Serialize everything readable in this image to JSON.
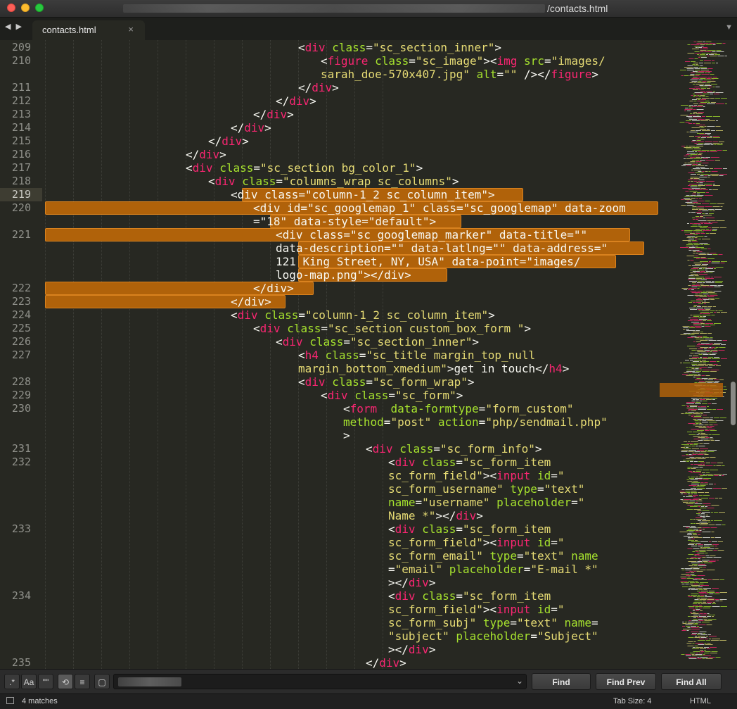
{
  "window": {
    "title_suffix": "/contacts.html",
    "title_path_redacted": true
  },
  "tabs": [
    {
      "label": "contacts.html",
      "close_icon": "×"
    }
  ],
  "nav_arrows": "◀ ▶",
  "colors": {
    "background": "#272822",
    "tag": "#f92672",
    "attribute": "#a6e22e",
    "string": "#e6db74",
    "text": "#f8f8f2",
    "gutter": "#8f908a",
    "match_highlight": "#b0620a"
  },
  "editor": {
    "line_numbers": [
      "209",
      "210",
      "211",
      "212",
      "213",
      "214",
      "215",
      "216",
      "217",
      "218",
      "219",
      "220",
      "221",
      "222",
      "223",
      "224",
      "225",
      "226",
      "227",
      "228",
      "229",
      "230",
      "231",
      "232",
      "233",
      "234",
      "235"
    ],
    "current_line": "219",
    "code_lines": [
      {
        "segments": [
          [
            "p",
            "<"
          ],
          [
            "t",
            "div"
          ],
          [
            "p",
            " "
          ],
          [
            "a",
            "class"
          ],
          [
            "p",
            "="
          ],
          [
            "s",
            "\"sc_section_inner\""
          ],
          [
            "p",
            ">"
          ]
        ]
      },
      {
        "segments": [
          [
            "p",
            "<"
          ],
          [
            "t",
            "figure"
          ],
          [
            "p",
            " "
          ],
          [
            "a",
            "class"
          ],
          [
            "p",
            "="
          ],
          [
            "s",
            "\"sc_image\""
          ],
          [
            "p",
            "><"
          ],
          [
            "t",
            "img"
          ],
          [
            "p",
            " "
          ],
          [
            "a",
            "src"
          ],
          [
            "p",
            "="
          ],
          [
            "s",
            "\"images/"
          ]
        ]
      },
      {
        "segments": [
          [
            "s",
            "sarah_doe-570x407.jpg\""
          ],
          [
            "p",
            " "
          ],
          [
            "a",
            "alt"
          ],
          [
            "p",
            "="
          ],
          [
            "s",
            "\"\""
          ],
          [
            "p",
            " /></"
          ],
          [
            "t",
            "figure"
          ],
          [
            "p",
            ">"
          ]
        ]
      },
      {
        "segments": [
          [
            "p",
            "</"
          ],
          [
            "t",
            "div"
          ],
          [
            "p",
            ">"
          ]
        ]
      },
      {
        "segments": [
          [
            "p",
            "</"
          ],
          [
            "t",
            "div"
          ],
          [
            "p",
            ">"
          ]
        ]
      },
      {
        "segments": [
          [
            "p",
            "</"
          ],
          [
            "t",
            "div"
          ],
          [
            "p",
            ">"
          ]
        ]
      },
      {
        "segments": [
          [
            "p",
            "</"
          ],
          [
            "t",
            "div"
          ],
          [
            "p",
            ">"
          ]
        ]
      },
      {
        "segments": [
          [
            "p",
            "</"
          ],
          [
            "t",
            "div"
          ],
          [
            "p",
            ">"
          ]
        ]
      },
      {
        "segments": [
          [
            "p",
            "</"
          ],
          [
            "t",
            "div"
          ],
          [
            "p",
            ">"
          ]
        ]
      },
      {
        "segments": [
          [
            "p",
            "<"
          ],
          [
            "t",
            "div"
          ],
          [
            "p",
            " "
          ],
          [
            "a",
            "class"
          ],
          [
            "p",
            "="
          ],
          [
            "s",
            "\"sc_section bg_color_1\""
          ],
          [
            "p",
            ">"
          ]
        ]
      },
      {
        "segments": [
          [
            "p",
            "<"
          ],
          [
            "t",
            "div"
          ],
          [
            "p",
            " "
          ],
          [
            "a",
            "class"
          ],
          [
            "p",
            "="
          ],
          [
            "s",
            "\"columns_wrap sc_columns\""
          ],
          [
            "p",
            ">"
          ]
        ]
      },
      {
        "segments": [
          [
            "p",
            "<div class=\"column-1_2 sc_column_item\">"
          ]
        ]
      },
      {
        "segments": [
          [
            "p",
            "<div id=\"sc_googlemap_1\" class=\"sc_googlemap\" data-zoom"
          ]
        ]
      },
      {
        "segments": [
          [
            "p",
            "=\"18\" data-style=\"default\">"
          ]
        ]
      },
      {
        "segments": [
          [
            "p",
            "<div class=\"sc_googlemap_marker\" data-title=\"\""
          ]
        ]
      },
      {
        "segments": [
          [
            "p",
            "data-description=\"\" data-latlng=\"\" data-address=\""
          ]
        ]
      },
      {
        "segments": [
          [
            "p",
            "121 King Street, NY, USA\" data-point=\"images/"
          ]
        ]
      },
      {
        "segments": [
          [
            "p",
            "logo-map.png\"></div>"
          ]
        ]
      },
      {
        "segments": [
          [
            "p",
            "</div>"
          ]
        ]
      },
      {
        "segments": [
          [
            "p",
            "</div>"
          ]
        ]
      },
      {
        "segments": [
          [
            "p",
            "<"
          ],
          [
            "t",
            "div"
          ],
          [
            "p",
            " "
          ],
          [
            "a",
            "class"
          ],
          [
            "p",
            "="
          ],
          [
            "s",
            "\"column-1_2 sc_column_item\""
          ],
          [
            "p",
            ">"
          ]
        ]
      },
      {
        "segments": [
          [
            "p",
            "<"
          ],
          [
            "t",
            "div"
          ],
          [
            "p",
            " "
          ],
          [
            "a",
            "class"
          ],
          [
            "p",
            "="
          ],
          [
            "s",
            "\"sc_section custom_box_form \""
          ],
          [
            "p",
            ">"
          ]
        ]
      },
      {
        "segments": [
          [
            "p",
            "<"
          ],
          [
            "t",
            "div"
          ],
          [
            "p",
            " "
          ],
          [
            "a",
            "class"
          ],
          [
            "p",
            "="
          ],
          [
            "s",
            "\"sc_section_inner\""
          ],
          [
            "p",
            ">"
          ]
        ]
      },
      {
        "segments": [
          [
            "p",
            "<"
          ],
          [
            "t",
            "h4"
          ],
          [
            "p",
            " "
          ],
          [
            "a",
            "class"
          ],
          [
            "p",
            "="
          ],
          [
            "s",
            "\"sc_title margin_top_null"
          ]
        ]
      },
      {
        "segments": [
          [
            "s",
            "margin_bottom_xmedium\""
          ],
          [
            "p",
            ">get in touch</"
          ],
          [
            "t",
            "h4"
          ],
          [
            "p",
            ">"
          ]
        ]
      },
      {
        "segments": [
          [
            "p",
            "<"
          ],
          [
            "t",
            "div"
          ],
          [
            "p",
            " "
          ],
          [
            "a",
            "class"
          ],
          [
            "p",
            "="
          ],
          [
            "s",
            "\"sc_form_wrap\""
          ],
          [
            "p",
            ">"
          ]
        ]
      },
      {
        "segments": [
          [
            "p",
            "<"
          ],
          [
            "t",
            "div"
          ],
          [
            "p",
            " "
          ],
          [
            "a",
            "class"
          ],
          [
            "p",
            "="
          ],
          [
            "s",
            "\"sc_form\""
          ],
          [
            "p",
            ">"
          ]
        ]
      },
      {
        "segments": [
          [
            "p",
            "<"
          ],
          [
            "t",
            "form"
          ],
          [
            "p",
            "  "
          ],
          [
            "a",
            "data-formtype"
          ],
          [
            "p",
            "="
          ],
          [
            "s",
            "\"form_custom\""
          ]
        ]
      },
      {
        "segments": [
          [
            "a",
            "method"
          ],
          [
            "p",
            "="
          ],
          [
            "s",
            "\"post\""
          ],
          [
            "p",
            " "
          ],
          [
            "a",
            "action"
          ],
          [
            "p",
            "="
          ],
          [
            "s",
            "\"php/sendmail.php\""
          ]
        ]
      },
      {
        "segments": [
          [
            "p",
            ">"
          ]
        ]
      },
      {
        "segments": [
          [
            "p",
            "<"
          ],
          [
            "t",
            "div"
          ],
          [
            "p",
            " "
          ],
          [
            "a",
            "class"
          ],
          [
            "p",
            "="
          ],
          [
            "s",
            "\"sc_form_info\""
          ],
          [
            "p",
            ">"
          ]
        ]
      },
      {
        "segments": [
          [
            "p",
            "<"
          ],
          [
            "t",
            "div"
          ],
          [
            "p",
            " "
          ],
          [
            "a",
            "class"
          ],
          [
            "p",
            "="
          ],
          [
            "s",
            "\"sc_form_item"
          ]
        ]
      },
      {
        "segments": [
          [
            "s",
            "sc_form_field\""
          ],
          [
            "p",
            "><"
          ],
          [
            "t",
            "input"
          ],
          [
            "p",
            " "
          ],
          [
            "a",
            "id"
          ],
          [
            "p",
            "="
          ],
          [
            "s",
            "\""
          ]
        ]
      },
      {
        "segments": [
          [
            "s",
            "sc_form_username\""
          ],
          [
            "p",
            " "
          ],
          [
            "a",
            "type"
          ],
          [
            "p",
            "="
          ],
          [
            "s",
            "\"text\""
          ]
        ]
      },
      {
        "segments": [
          [
            "a",
            "name"
          ],
          [
            "p",
            "="
          ],
          [
            "s",
            "\"username\""
          ],
          [
            "p",
            " "
          ],
          [
            "a",
            "placeholder"
          ],
          [
            "p",
            "="
          ],
          [
            "s",
            "\""
          ]
        ]
      },
      {
        "segments": [
          [
            "s",
            "Name *\""
          ],
          [
            "p",
            "></"
          ],
          [
            "t",
            "div"
          ],
          [
            "p",
            ">"
          ]
        ]
      },
      {
        "segments": [
          [
            "p",
            "<"
          ],
          [
            "t",
            "div"
          ],
          [
            "p",
            " "
          ],
          [
            "a",
            "class"
          ],
          [
            "p",
            "="
          ],
          [
            "s",
            "\"sc_form_item"
          ]
        ]
      },
      {
        "segments": [
          [
            "s",
            "sc_form_field\""
          ],
          [
            "p",
            "><"
          ],
          [
            "t",
            "input"
          ],
          [
            "p",
            " "
          ],
          [
            "a",
            "id"
          ],
          [
            "p",
            "="
          ],
          [
            "s",
            "\""
          ]
        ]
      },
      {
        "segments": [
          [
            "s",
            "sc_form_email\""
          ],
          [
            "p",
            " "
          ],
          [
            "a",
            "type"
          ],
          [
            "p",
            "="
          ],
          [
            "s",
            "\"text\""
          ],
          [
            "p",
            " "
          ],
          [
            "a",
            "name"
          ]
        ]
      },
      {
        "segments": [
          [
            "p",
            "="
          ],
          [
            "s",
            "\"email\""
          ],
          [
            "p",
            " "
          ],
          [
            "a",
            "placeholder"
          ],
          [
            "p",
            "="
          ],
          [
            "s",
            "\"E-mail *\""
          ]
        ]
      },
      {
        "segments": [
          [
            "p",
            "></"
          ],
          [
            "t",
            "div"
          ],
          [
            "p",
            ">"
          ]
        ]
      },
      {
        "segments": [
          [
            "p",
            "<"
          ],
          [
            "t",
            "div"
          ],
          [
            "p",
            " "
          ],
          [
            "a",
            "class"
          ],
          [
            "p",
            "="
          ],
          [
            "s",
            "\"sc_form_item"
          ]
        ]
      },
      {
        "segments": [
          [
            "s",
            "sc_form_field\""
          ],
          [
            "p",
            "><"
          ],
          [
            "t",
            "input"
          ],
          [
            "p",
            " "
          ],
          [
            "a",
            "id"
          ],
          [
            "p",
            "="
          ],
          [
            "s",
            "\""
          ]
        ]
      },
      {
        "segments": [
          [
            "s",
            "sc_form_subj\""
          ],
          [
            "p",
            " "
          ],
          [
            "a",
            "type"
          ],
          [
            "p",
            "="
          ],
          [
            "s",
            "\"text\""
          ],
          [
            "p",
            " "
          ],
          [
            "a",
            "name"
          ],
          [
            "p",
            "="
          ]
        ]
      },
      {
        "segments": [
          [
            "s",
            "\"subject\""
          ],
          [
            "p",
            " "
          ],
          [
            "a",
            "placeholder"
          ],
          [
            "p",
            "="
          ],
          [
            "s",
            "\"Subject\""
          ]
        ]
      },
      {
        "segments": [
          [
            "p",
            "></"
          ],
          [
            "t",
            "div"
          ],
          [
            "p",
            ">"
          ]
        ]
      },
      {
        "segments": [
          [
            "p",
            "</"
          ],
          [
            "t",
            "div"
          ],
          [
            "p",
            ">"
          ]
        ]
      }
    ]
  },
  "find_bar": {
    "regex_toggle": ".*",
    "case_toggle": "Aa",
    "word_toggle": "\"\"",
    "wrap_icon": "wrap-icon",
    "in_selection_icon": "in-selection-icon",
    "highlight_icon": "highlight-icon",
    "search_value_redacted": true,
    "find_label": "Find",
    "find_prev_label": "Find Prev",
    "find_all_label": "Find All"
  },
  "status_bar": {
    "matches": "4 matches",
    "tab_size": "Tab Size: 4",
    "syntax": "HTML"
  }
}
